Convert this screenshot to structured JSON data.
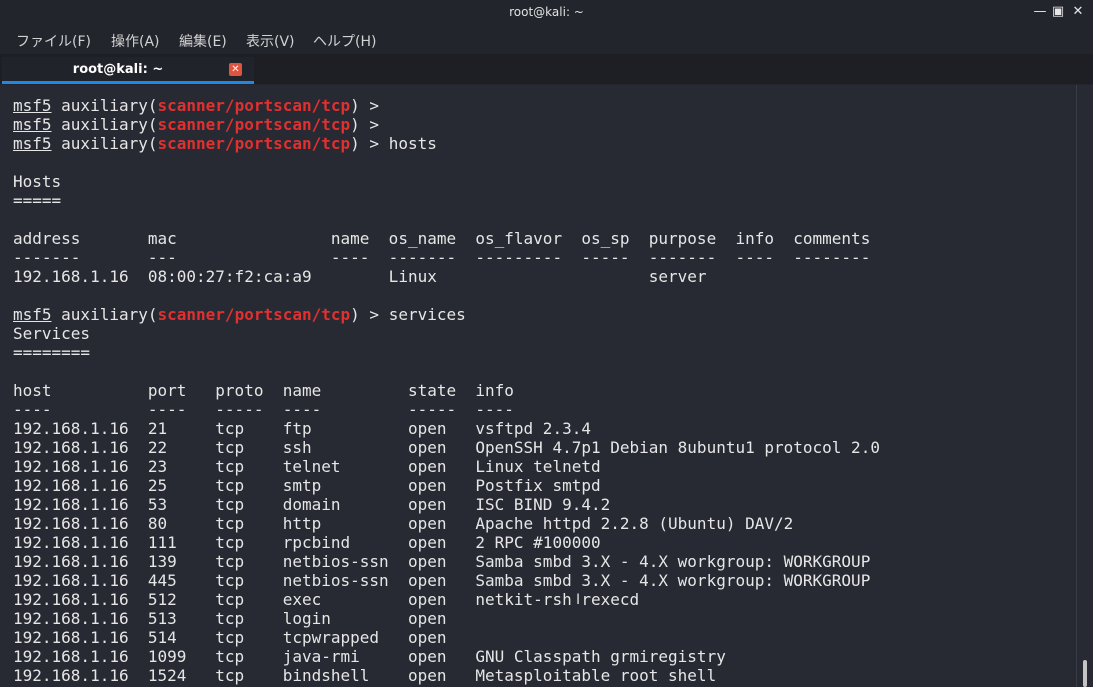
{
  "window": {
    "title": "root@kali: ~"
  },
  "menu": [
    "ファイル(F)",
    "操作(A)",
    "編集(E)",
    "表示(V)",
    "ヘルプ(H)"
  ],
  "tab": {
    "label": "root@kali: ~"
  },
  "colors": {
    "background": "#272a33",
    "module_red": "#e0302f",
    "tab_accent": "#1e88e5",
    "close_red": "#e0533f"
  },
  "terminal": {
    "lines": [
      {
        "type": "prompt",
        "msf": "msf5",
        "pre": " auxiliary(",
        "module": "scanner/portscan/tcp",
        "post": ") >"
      },
      {
        "type": "prompt",
        "msf": "msf5",
        "pre": " auxiliary(",
        "module": "scanner/portscan/tcp",
        "post": ") >"
      },
      {
        "type": "prompt",
        "msf": "msf5",
        "pre": " auxiliary(",
        "module": "scanner/portscan/tcp",
        "post": ") > hosts"
      },
      {
        "type": "text",
        "text": ""
      },
      {
        "type": "text",
        "text": "Hosts"
      },
      {
        "type": "text",
        "text": "====="
      },
      {
        "type": "text",
        "text": ""
      },
      {
        "type": "text",
        "text": "address       mac                name  os_name  os_flavor  os_sp  purpose  info  comments"
      },
      {
        "type": "text",
        "text": "-------       ---                ----  -------  ---------  -----  -------  ----  --------"
      },
      {
        "type": "text",
        "text": "192.168.1.16  08:00:27:f2:ca:a9        Linux                      server"
      },
      {
        "type": "text",
        "text": ""
      },
      {
        "type": "prompt",
        "msf": "msf5",
        "pre": " auxiliary(",
        "module": "scanner/portscan/tcp",
        "post": ") > services"
      },
      {
        "type": "text",
        "text": "Services"
      },
      {
        "type": "text",
        "text": "========"
      },
      {
        "type": "text",
        "text": ""
      },
      {
        "type": "text",
        "text": "host          port   proto  name         state  info"
      },
      {
        "type": "text",
        "text": "----          ----   -----  ----         -----  ----"
      },
      {
        "type": "text",
        "text": "192.168.1.16  21     tcp    ftp          open   vsftpd 2.3.4"
      },
      {
        "type": "text",
        "text": "192.168.1.16  22     tcp    ssh          open   OpenSSH 4.7p1 Debian 8ubuntu1 protocol 2.0"
      },
      {
        "type": "text",
        "text": "192.168.1.16  23     tcp    telnet       open   Linux telnetd"
      },
      {
        "type": "text",
        "text": "192.168.1.16  25     tcp    smtp         open   Postfix smtpd"
      },
      {
        "type": "text",
        "text": "192.168.1.16  53     tcp    domain       open   ISC BIND 9.4.2"
      },
      {
        "type": "text",
        "text": "192.168.1.16  80     tcp    http         open   Apache httpd 2.2.8 (Ubuntu) DAV/2"
      },
      {
        "type": "text",
        "text": "192.168.1.16  111    tcp    rpcbind      open   2 RPC #100000"
      },
      {
        "type": "text",
        "text": "192.168.1.16  139    tcp    netbios-ssn  open   Samba smbd 3.X - 4.X workgroup: WORKGROUP"
      },
      {
        "type": "text",
        "text": "192.168.1.16  445    tcp    netbios-ssn  open   Samba smbd 3.X - 4.X workgroup: WORKGROUP"
      },
      {
        "type": "text",
        "text": "192.168.1.16  512    tcp    exec         open   netkit-rsh rexecd"
      },
      {
        "type": "text",
        "text": "192.168.1.16  513    tcp    login        open"
      },
      {
        "type": "text",
        "text": "192.168.1.16  514    tcp    tcpwrapped   open"
      },
      {
        "type": "text",
        "text": "192.168.1.16  1099   tcp    java-rmi     open   GNU Classpath grmiregistry"
      },
      {
        "type": "text",
        "text": "192.168.1.16  1524   tcp    bindshell    open   Metasploitable root shell"
      }
    ]
  }
}
